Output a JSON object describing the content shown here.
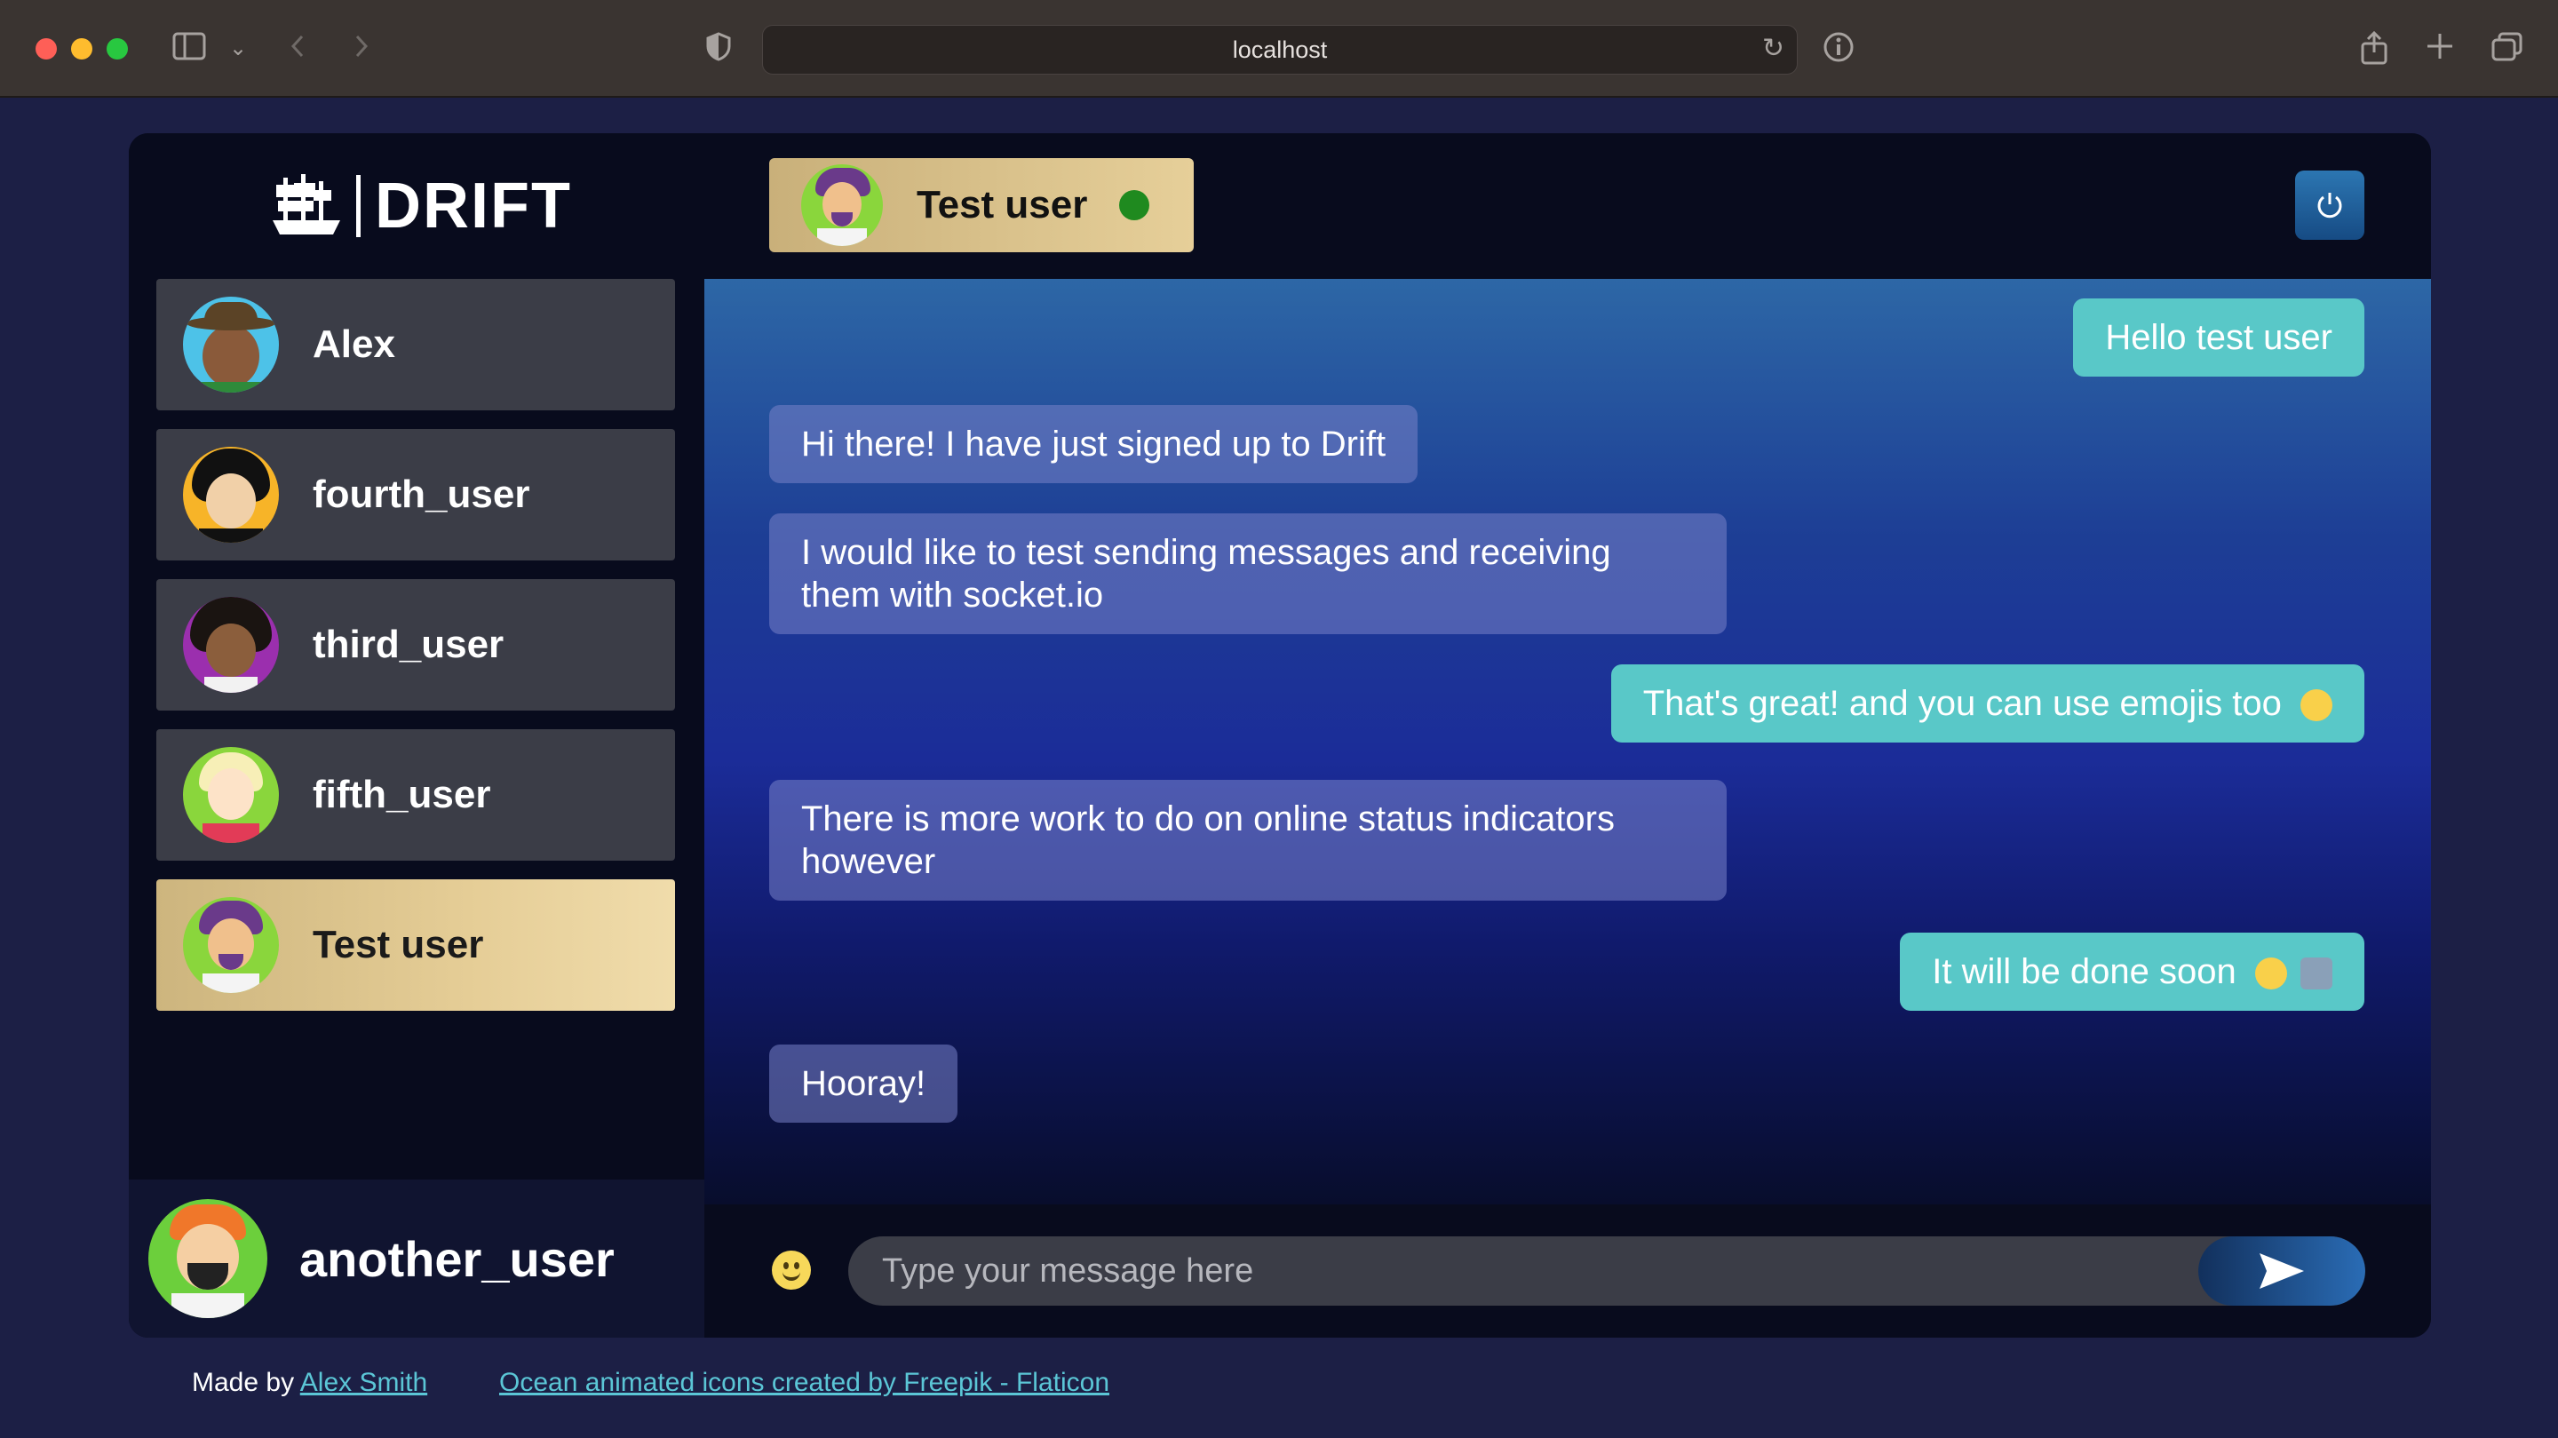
{
  "browser": {
    "url": "localhost"
  },
  "app": {
    "logo_text": "DRIFT",
    "users": [
      {
        "name": "Alex",
        "active": false
      },
      {
        "name": "fourth_user",
        "active": false
      },
      {
        "name": "third_user",
        "active": false
      },
      {
        "name": "fifth_user",
        "active": false
      },
      {
        "name": "Test user",
        "active": true
      }
    ],
    "current_user": "another_user",
    "chat_header": {
      "name": "Test user",
      "status": "online"
    },
    "messages": [
      {
        "text": "Hello test user",
        "direction": "sent"
      },
      {
        "text": "Hi there! I have just signed up to Drift",
        "direction": "received"
      },
      {
        "text": "I would like to test sending messages and receiving them with socket.io",
        "direction": "received"
      },
      {
        "text": "That's great! and you can use emojis too",
        "direction": "sent",
        "emoji": "smiley"
      },
      {
        "text": "There is more work to do on online status indicators however",
        "direction": "received"
      },
      {
        "text": "It will be done soon",
        "direction": "sent",
        "emoji": "nerd-face, technologist"
      },
      {
        "text": "Hooray!",
        "direction": "received"
      }
    ],
    "composer": {
      "placeholder": "Type your message here",
      "value": ""
    }
  },
  "footer": {
    "made_by_prefix": "Made by",
    "author_link": "Alex Smith",
    "credit_link": "Ocean animated icons created by Freepik - Flaticon"
  },
  "colors": {
    "sent_bubble": "#59c8c8",
    "active_user": "#e5cd96",
    "status_online": "#1f8a1f"
  }
}
